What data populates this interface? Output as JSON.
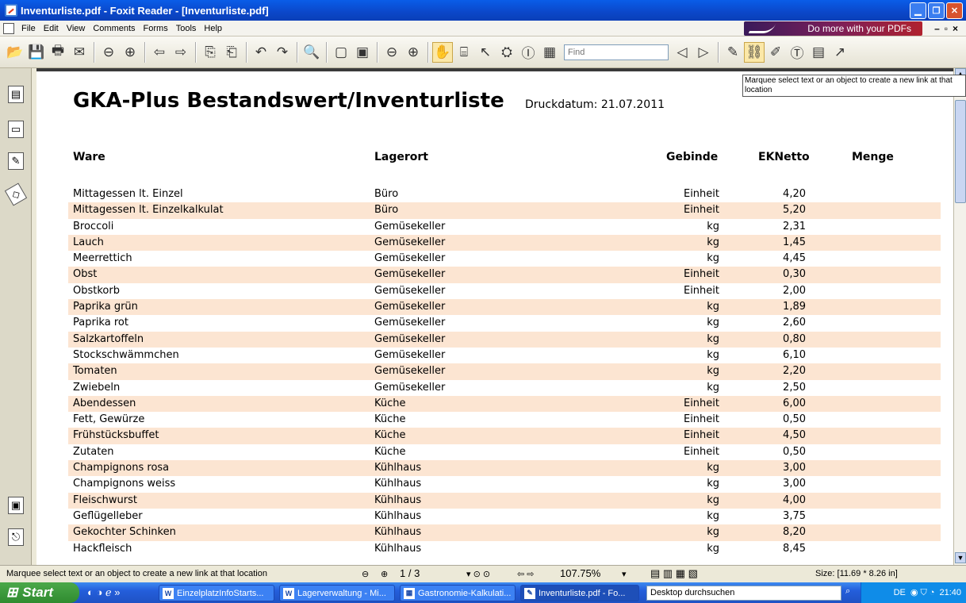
{
  "window": {
    "title": "Inventurliste.pdf - Foxit Reader - [Inventurliste.pdf]"
  },
  "menu": [
    "File",
    "Edit",
    "View",
    "Comments",
    "Forms",
    "Tools",
    "Help"
  ],
  "promo": "Do more with your PDFs",
  "toolbar": {
    "find_placeholder": "Find"
  },
  "tooltip": "Marquee select text or an object to create a new link at that location",
  "document": {
    "title": "GKA-Plus Bestandswert/Inventurliste",
    "print_date": "Druckdatum: 21.07.2011",
    "headers": {
      "ware": "Ware",
      "lagerort": "Lagerort",
      "gebinde": "Gebinde",
      "eknetto": "EKNetto",
      "menge": "Menge"
    },
    "rows": [
      {
        "ware": "Mittagessen lt. Einzel",
        "lagerort": "Büro",
        "gebinde": "Einheit",
        "eknetto": "4,20"
      },
      {
        "ware": "Mittagessen lt. Einzelkalkulat",
        "lagerort": "Büro",
        "gebinde": "Einheit",
        "eknetto": "5,20"
      },
      {
        "ware": "Broccoli",
        "lagerort": "Gemüsekeller",
        "gebinde": "kg",
        "eknetto": "2,31"
      },
      {
        "ware": "Lauch",
        "lagerort": "Gemüsekeller",
        "gebinde": "kg",
        "eknetto": "1,45"
      },
      {
        "ware": "Meerrettich",
        "lagerort": "Gemüsekeller",
        "gebinde": "kg",
        "eknetto": "4,45"
      },
      {
        "ware": "Obst",
        "lagerort": "Gemüsekeller",
        "gebinde": "Einheit",
        "eknetto": "0,30"
      },
      {
        "ware": "Obstkorb",
        "lagerort": "Gemüsekeller",
        "gebinde": "Einheit",
        "eknetto": "2,00"
      },
      {
        "ware": "Paprika grün",
        "lagerort": "Gemüsekeller",
        "gebinde": "kg",
        "eknetto": "1,89"
      },
      {
        "ware": "Paprika rot",
        "lagerort": "Gemüsekeller",
        "gebinde": "kg",
        "eknetto": "2,60"
      },
      {
        "ware": "Salzkartoffeln",
        "lagerort": "Gemüsekeller",
        "gebinde": "kg",
        "eknetto": "0,80"
      },
      {
        "ware": "Stockschwämmchen",
        "lagerort": "Gemüsekeller",
        "gebinde": "kg",
        "eknetto": "6,10"
      },
      {
        "ware": "Tomaten",
        "lagerort": "Gemüsekeller",
        "gebinde": "kg",
        "eknetto": "2,20"
      },
      {
        "ware": "Zwiebeln",
        "lagerort": "Gemüsekeller",
        "gebinde": "kg",
        "eknetto": "2,50"
      },
      {
        "ware": "Abendessen",
        "lagerort": "Küche",
        "gebinde": "Einheit",
        "eknetto": "6,00"
      },
      {
        "ware": "Fett, Gewürze",
        "lagerort": "Küche",
        "gebinde": "Einheit",
        "eknetto": "0,50"
      },
      {
        "ware": "Frühstücksbuffet",
        "lagerort": "Küche",
        "gebinde": "Einheit",
        "eknetto": "4,50"
      },
      {
        "ware": "Zutaten",
        "lagerort": "Küche",
        "gebinde": "Einheit",
        "eknetto": "0,50"
      },
      {
        "ware": "Champignons rosa",
        "lagerort": "Kühlhaus",
        "gebinde": "kg",
        "eknetto": "3,00"
      },
      {
        "ware": "Champignons weiss",
        "lagerort": "Kühlhaus",
        "gebinde": "kg",
        "eknetto": "3,00"
      },
      {
        "ware": "Fleischwurst",
        "lagerort": "Kühlhaus",
        "gebinde": "kg",
        "eknetto": "4,00"
      },
      {
        "ware": "Geflügelleber",
        "lagerort": "Kühlhaus",
        "gebinde": "kg",
        "eknetto": "3,75"
      },
      {
        "ware": "Gekochter Schinken",
        "lagerort": "Kühlhaus",
        "gebinde": "kg",
        "eknetto": "8,20"
      },
      {
        "ware": "Hackfleisch",
        "lagerort": "Kühlhaus",
        "gebinde": "kg",
        "eknetto": "8,45"
      }
    ]
  },
  "status": {
    "message": "Marquee select text or an object to create a new link at that location",
    "page": "1 / 3",
    "zoom": "107.75%",
    "size": "Size: [11.69 * 8.26 in]"
  },
  "taskbar": {
    "start": "Start",
    "items": [
      "EinzelplatzInfoStarts...",
      "Lagerverwaltung - Mi...",
      "Gastronomie-Kalkulati...",
      "Inventurliste.pdf - Fo..."
    ],
    "search": "Desktop durchsuchen",
    "lang": "DE",
    "clock": "21:40"
  },
  "colors": {
    "row_alt": "#fce5d2",
    "titlebar": "#0b47c9"
  }
}
